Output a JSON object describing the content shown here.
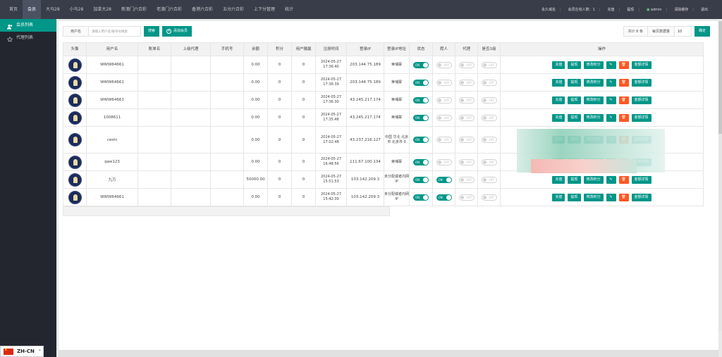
{
  "nav": {
    "items": [
      "首页",
      "会员",
      "大马28",
      "小马28",
      "加拿大28",
      "新澳门六合彩",
      "老澳门六合彩",
      "香港六合彩",
      "五分六合彩",
      "上下分管理",
      "统计"
    ],
    "active_index": 1,
    "right": {
      "permanent": "永久域名",
      "online_label": "会员在线人数：",
      "online_count": "1",
      "recharge": "充值",
      "withdraw": "提现",
      "admin": "admin",
      "clear_cache": "清除缓存",
      "logout": "退出"
    }
  },
  "sidebar": {
    "items": [
      {
        "label": "会员列表",
        "active": true,
        "icon": "user-group-icon"
      },
      {
        "label": "代理列表",
        "active": false,
        "icon": "star-icon"
      }
    ]
  },
  "language": "ZH-CN",
  "toolbar": {
    "username_label": "用户名",
    "search_placeholder": "请输入用户名/账单号搜索",
    "search_button": "搜索",
    "add_button": "添加会员"
  },
  "pager": {
    "total_label": "共计 8 条",
    "per_page_label": "每页数据量",
    "per_page_value": "10",
    "confirm_button": "确定"
  },
  "table": {
    "headers": [
      "头像",
      "用户名",
      "账单名",
      "上级代理",
      "手机号",
      "余额",
      "积分",
      "用户输赢",
      "注册时间",
      "登录IP",
      "登录IP地址",
      "状态",
      "假人",
      "代理",
      "是否1级",
      "操作"
    ],
    "rows": [
      {
        "username": "WWW64661",
        "nickname": "",
        "parent": "",
        "phone": "",
        "balance": "0.00",
        "points": "0",
        "winloss": "0",
        "reg_date": "2024-05-27",
        "reg_time": "17:36:40",
        "ip": "203.144.75.189",
        "ip_addr": "柬埔寨",
        "status": "ON",
        "fake": "OFF",
        "agent": "OFF",
        "level1": "OFF"
      },
      {
        "username": "WWW64661",
        "nickname": "",
        "parent": "",
        "phone": "",
        "balance": "0.00",
        "points": "0",
        "winloss": "0",
        "reg_date": "2024-05-27",
        "reg_time": "17:36:39",
        "ip": "203.144.75.189",
        "ip_addr": "柬埔寨",
        "status": "ON",
        "fake": "OFF",
        "agent": "OFF",
        "level1": "OFF"
      },
      {
        "username": "WWW64661",
        "nickname": "",
        "parent": "",
        "phone": "",
        "balance": "0.00",
        "points": "0",
        "winloss": "0",
        "reg_date": "2024-05-27",
        "reg_time": "17:36:30",
        "ip": "43.245.217.174",
        "ip_addr": "柬埔寨",
        "status": "ON",
        "fake": "OFF",
        "agent": "OFF",
        "level1": "OFF"
      },
      {
        "username": "1008611",
        "nickname": "",
        "parent": "",
        "phone": "",
        "balance": "0.00",
        "points": "0",
        "winloss": "0",
        "reg_date": "2024-05-27",
        "reg_time": "17:35:48",
        "ip": "43.245.217.174",
        "ip_addr": "柬埔寨",
        "status": "ON",
        "fake": "OFF",
        "agent": "OFF",
        "level1": "OFF"
      },
      {
        "username": "ceshi",
        "nickname": "",
        "parent": "",
        "phone": "",
        "balance": "0.00",
        "points": "0",
        "winloss": "0",
        "reg_date": "2024-05-27",
        "reg_time": "17:02:48",
        "ip": "43.237.216.127",
        "ip_addr": "中国 华北 北京市 北京市 0",
        "status": "ON",
        "fake": "OFF",
        "agent": "OFF",
        "level1": "OFF",
        "tall": true
      },
      {
        "username": "qwe123",
        "nickname": "",
        "parent": "",
        "phone": "",
        "balance": "0.00",
        "points": "0",
        "winloss": "0",
        "reg_date": "2024-05-27",
        "reg_time": "16:48:56",
        "ip": "111.67.100.134",
        "ip_addr": "柬埔寨",
        "status": "ON",
        "fake": "OFF",
        "agent": "OFF",
        "level1": "OFF"
      },
      {
        "username": "九万",
        "nickname": "",
        "parent": "",
        "phone": "",
        "balance": "50000.00",
        "points": "0",
        "winloss": "0",
        "reg_date": "2024-05-27",
        "reg_time": "15:51:53",
        "ip": "103.142.209.3",
        "ip_addr": "未分配或者内网IP",
        "status": "ON",
        "fake": "ON",
        "agent": "OFF",
        "level1": "OFF"
      },
      {
        "username": "WWW64661",
        "nickname": "",
        "parent": "",
        "phone": "",
        "balance": "0.00",
        "points": "0",
        "winloss": "0",
        "reg_date": "2024-05-27",
        "reg_time": "15:42:39",
        "ip": "103.142.209.3",
        "ip_addr": "未分配或者内网IP",
        "status": "ON",
        "fake": "ON",
        "agent": "OFF",
        "level1": "OFF"
      }
    ],
    "op_labels": {
      "recharge": "充值",
      "withdraw": "提现",
      "edit_points": "修改积分",
      "edit_icon": "✎",
      "delete_icon": "🗑",
      "detail": "金额详情"
    }
  }
}
